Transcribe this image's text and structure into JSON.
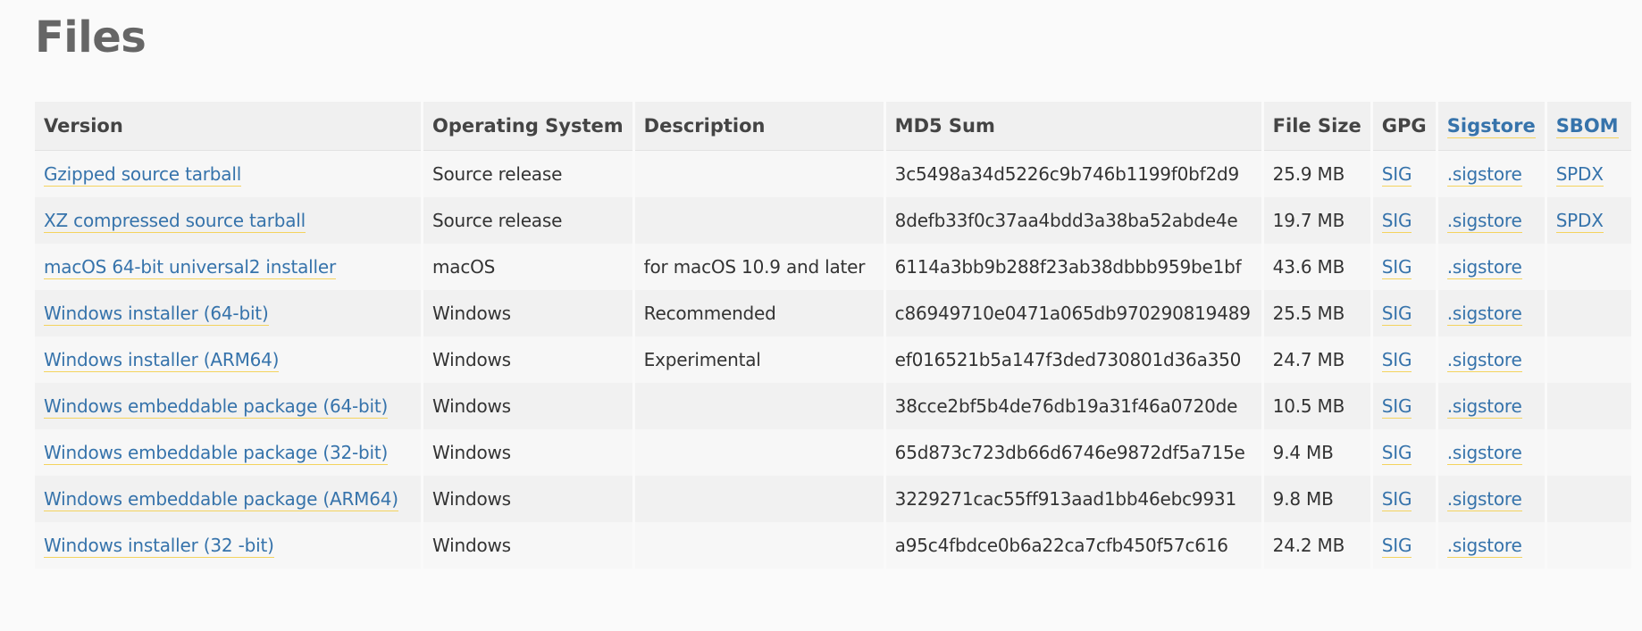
{
  "page": {
    "title": "Files"
  },
  "table": {
    "headers": {
      "version": "Version",
      "os": "Operating System",
      "description": "Description",
      "md5": "MD5 Sum",
      "size": "File Size",
      "gpg": "GPG",
      "sigstore": "Sigstore",
      "sbom": "SBOM"
    },
    "rows": [
      {
        "version": "Gzipped source tarball",
        "os": "Source release",
        "description": "",
        "md5": "3c5498a34d5226c9b746b1199f0bf2d9",
        "size": "25.9 MB",
        "gpg": "SIG",
        "sigstore": ".sigstore",
        "sbom": "SPDX"
      },
      {
        "version": "XZ compressed source tarball",
        "os": "Source release",
        "description": "",
        "md5": "8defb33f0c37aa4bdd3a38ba52abde4e",
        "size": "19.7 MB",
        "gpg": "SIG",
        "sigstore": ".sigstore",
        "sbom": "SPDX"
      },
      {
        "version": "macOS 64-bit universal2 installer",
        "os": "macOS",
        "description": "for macOS 10.9 and later",
        "md5": "6114a3bb9b288f23ab38dbbb959be1bf",
        "size": "43.6 MB",
        "gpg": "SIG",
        "sigstore": ".sigstore",
        "sbom": ""
      },
      {
        "version": "Windows installer (64-bit)",
        "os": "Windows",
        "description": "Recommended",
        "md5": "c86949710e0471a065db970290819489",
        "size": "25.5 MB",
        "gpg": "SIG",
        "sigstore": ".sigstore",
        "sbom": ""
      },
      {
        "version": "Windows installer (ARM64)",
        "os": "Windows",
        "description": "Experimental",
        "md5": "ef016521b5a147f3ded730801d36a350",
        "size": "24.7 MB",
        "gpg": "SIG",
        "sigstore": ".sigstore",
        "sbom": ""
      },
      {
        "version": "Windows embeddable package (64-bit)",
        "os": "Windows",
        "description": "",
        "md5": "38cce2bf5b4de76db19a31f46a0720de",
        "size": "10.5 MB",
        "gpg": "SIG",
        "sigstore": ".sigstore",
        "sbom": ""
      },
      {
        "version": "Windows embeddable package (32-bit)",
        "os": "Windows",
        "description": "",
        "md5": "65d873c723db66d6746e9872df5a715e",
        "size": "9.4 MB",
        "gpg": "SIG",
        "sigstore": ".sigstore",
        "sbom": ""
      },
      {
        "version": "Windows embeddable package (ARM64)",
        "os": "Windows",
        "description": "",
        "md5": "3229271cac55ff913aad1bb46ebc9931",
        "size": "9.8 MB",
        "gpg": "SIG",
        "sigstore": ".sigstore",
        "sbom": ""
      },
      {
        "version": "Windows installer (32 -bit)",
        "os": "Windows",
        "description": "",
        "md5": "a95c4fbdce0b6a22ca7cfb450f57c616",
        "size": "24.2 MB",
        "gpg": "SIG",
        "sigstore": ".sigstore",
        "sbom": ""
      }
    ]
  },
  "colors": {
    "link": "#3673ab",
    "link_underline": "#f4d35e",
    "title": "#666666",
    "header_bg": "#f0f0f0",
    "row_odd_bg": "#f7f7f7",
    "row_even_bg": "#f1f1f1"
  }
}
